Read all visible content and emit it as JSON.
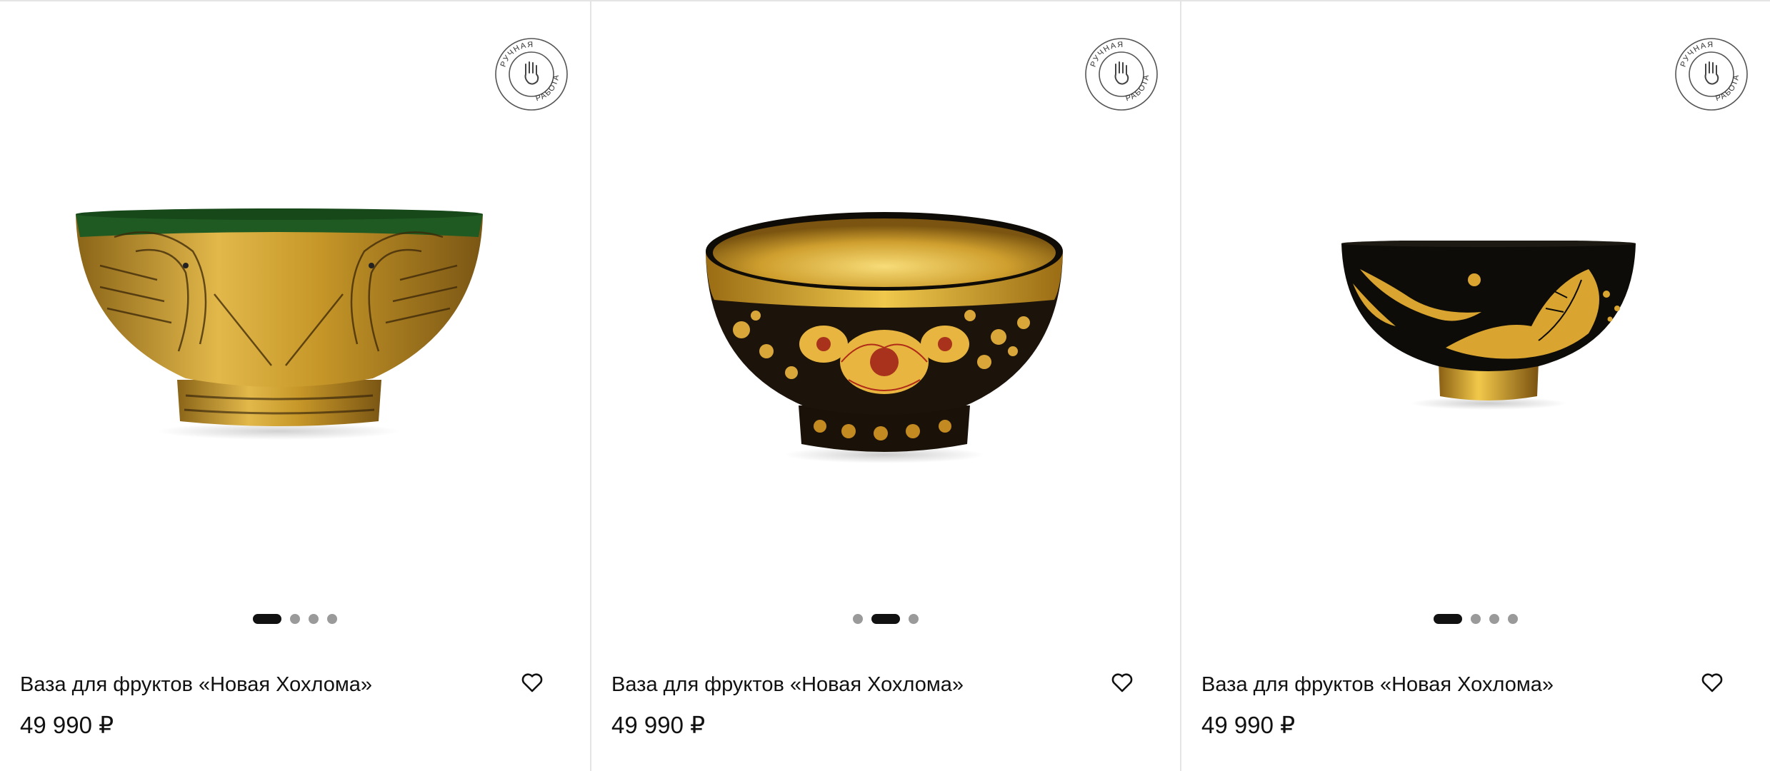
{
  "badge": {
    "top_text": "РУЧНАЯ",
    "bottom_text": "РАБОТА",
    "icon": "hand-icon"
  },
  "products": [
    {
      "title": "Ваза для фруктов «Новая Хохлома»",
      "price": "49 990 ₽",
      "image_slides": 4,
      "active_slide": 1,
      "image": "green-gold-bowl-with-birds"
    },
    {
      "title": "Ваза для фруктов «Новая Хохлома»",
      "price": "49 990 ₽",
      "image_slides": 3,
      "active_slide": 2,
      "image": "gold-floral-khokhloma-bowl"
    },
    {
      "title": "Ваза для фруктов «Новая Хохлома»",
      "price": "49 990 ₽",
      "image_slides": 4,
      "active_slide": 1,
      "image": "black-gold-leaf-bowl"
    }
  ],
  "colors": {
    "gold": "#c99a28",
    "green": "#1f5a22",
    "black": "#111111",
    "dot_inactive": "#9a9a9a",
    "border": "#e4e4e4"
  }
}
